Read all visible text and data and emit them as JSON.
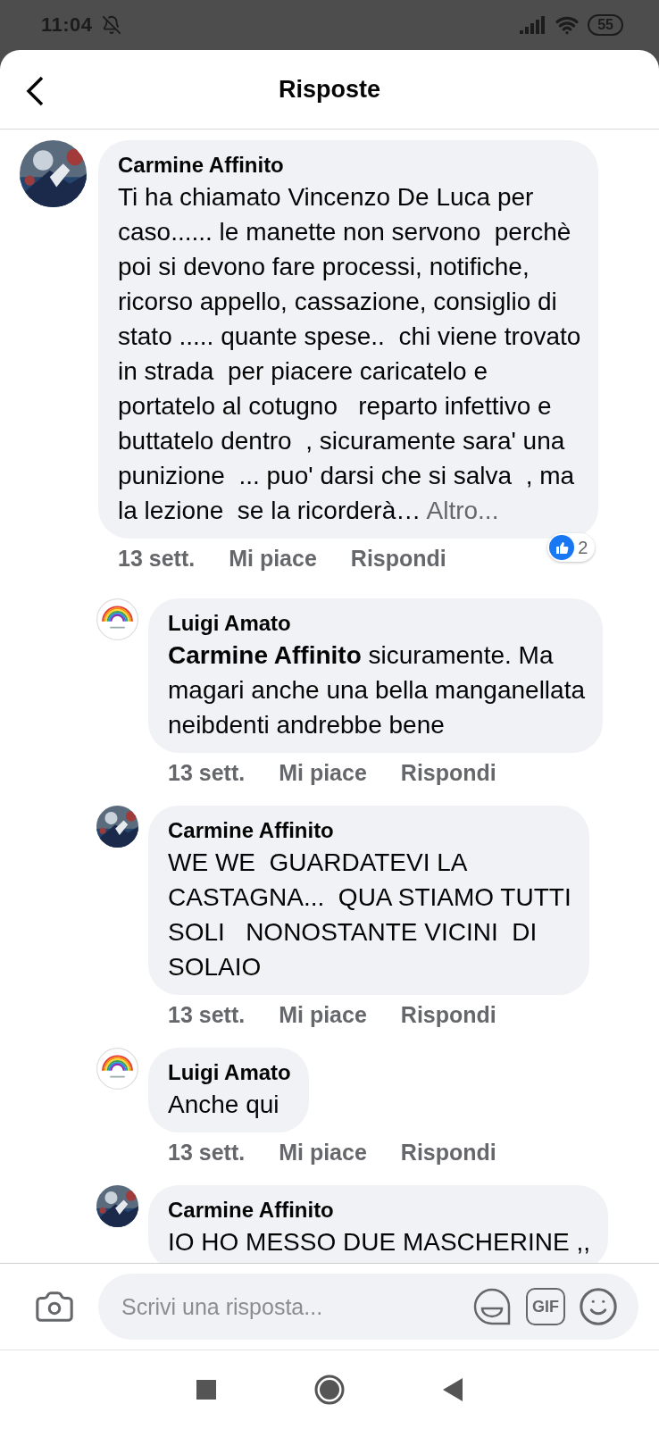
{
  "status_bar": {
    "time": "11:04",
    "battery": "55",
    "silent": true
  },
  "header": {
    "title": "Risposte"
  },
  "comments": [
    {
      "author": "Carmine Affinito",
      "text": "Ti ha chiamato Vincenzo De Luca per\ncaso...... le manette non servono  perchè\npoi si devono fare processi, notifiche,\nricorso appello, cassazione, consiglio di\nstato ..... quante spese..  chi viene trovato\nin strada  per piacere caricatelo e\nportatelo al cotugno   reparto infettivo e\nbuttatelo dentro  , sicuramente sara' una\npunizione  ... puo' darsi che si salva  , ma\nla lezione  se la ricorderà…",
      "more": "Altro...",
      "time": "13 sett.",
      "actions": [
        "Mi piace",
        "Rispondi"
      ],
      "reaction_count": "2",
      "replies": [
        {
          "author": "Luigi Amato",
          "avatar": {
            "kind": "logo"
          },
          "text": "**Carmine Affinito** sicuramente. Ma\nmagari anche una bella manganellata\nneibdenti andrebbe bene",
          "time": "13 sett.",
          "actions": [
            "Mi piace",
            "Rispondi"
          ]
        },
        {
          "author": "Carmine Affinito",
          "text": "WE WE  GUARDATEVI LA\nCASTAGNA...  QUA STIAMO TUTTI\nSOLI   NONOSTANTE VICINI  DI\nSOLAIO",
          "time": "13 sett.",
          "actions": [
            "Mi piace",
            "Rispondi"
          ]
        },
        {
          "author": "Luigi Amato",
          "avatar": {
            "kind": "logo"
          },
          "text": "Anche qui",
          "time": "13 sett.",
          "actions": [
            "Mi piace",
            "Rispondi"
          ]
        },
        {
          "author": "Carmine Affinito",
          "text": "IO HO MESSO DUE MASCHERINE ,,"
        }
      ]
    }
  ],
  "composer": {
    "placeholder": "Scrivi una risposta...",
    "gif_label": "GIF"
  }
}
